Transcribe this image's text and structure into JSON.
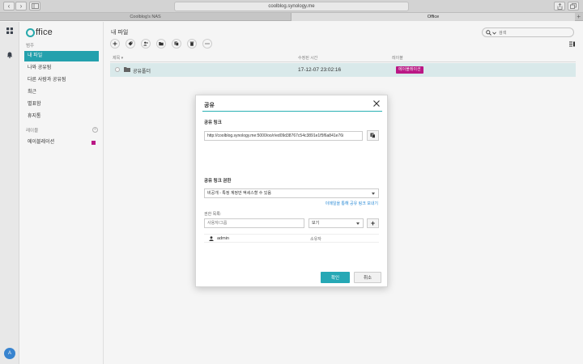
{
  "browser": {
    "url": "coolblog.synology.me",
    "tabs": [
      {
        "label": "Coolblog's NAS"
      },
      {
        "label": "Office"
      }
    ],
    "new_tab_label": "+"
  },
  "rail": {
    "avatar_letter": "A"
  },
  "app": {
    "logo_text": "ffice",
    "brand_color": "#2ab0b4"
  },
  "sidebar": {
    "category_label": "범주",
    "items": [
      {
        "label": "내 파일"
      },
      {
        "label": "나와 공유됨"
      },
      {
        "label": "다른 사람과 공유됨"
      },
      {
        "label": "최근"
      },
      {
        "label": "별표함"
      },
      {
        "label": "휴지통"
      }
    ],
    "labels_heading": "레이블",
    "labels_add": "+",
    "labels": [
      {
        "label": "에이블레이션",
        "color": "#c2188b"
      }
    ]
  },
  "main": {
    "title": "내 파일",
    "search_placeholder": "검색",
    "columns": {
      "name": "제목 ▾",
      "modified": "수정된 시간",
      "label": "레이블"
    },
    "rows": [
      {
        "name": "공유폴더",
        "modified": "17-12-07 23:02:16",
        "label": "에이블레이션"
      }
    ]
  },
  "dialog": {
    "title": "공유",
    "link_section_label": "공유 링크",
    "link_value": "http://coolblog.synology.me:5000/oo/r/ed09d38767c54c3891e1f5f6a841e76i",
    "permission_section_label": "공유 링크 권한",
    "permission_value": "비공개 - 특정 계정만 액세스할 수 있음",
    "email_link_label": "이메일을 통해 공유 링크 보내기",
    "permission_list_label": "권한 목록:",
    "user_placeholder": "사용자/그룹",
    "role_value": "보기",
    "add_label": "+",
    "users": [
      {
        "name": "admin",
        "role": "소유자"
      }
    ],
    "ok_label": "확인",
    "cancel_label": "취소"
  }
}
